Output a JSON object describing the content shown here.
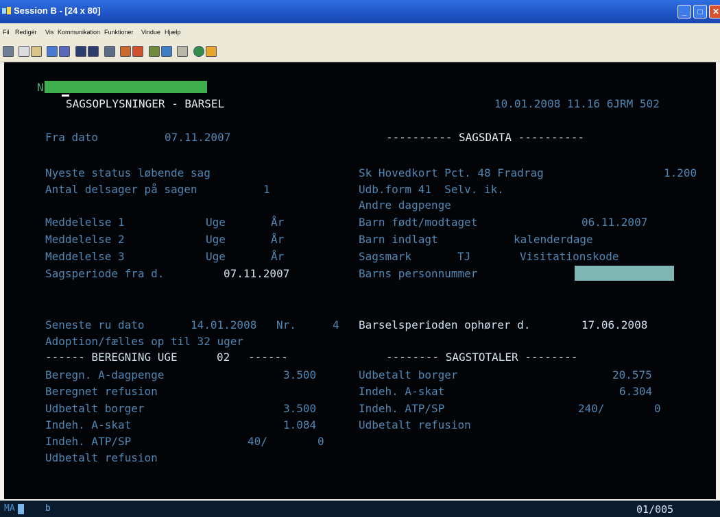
{
  "window": {
    "title": "Session B - [24 x 80]",
    "buttons": {
      "minimize": "_",
      "maximize": "□",
      "close": "✕"
    }
  },
  "menu": [
    "Fil",
    "Redigér",
    "Vis",
    "Kommunikation",
    "Funktioner",
    "Vindue",
    "Hjælp"
  ],
  "toolbar_icons": [
    "print-screen-icon",
    "copy-icon",
    "paste-icon",
    "send-file-icon",
    "receive-file-icon",
    "display-icon",
    "display-alt-icon",
    "printer-icon",
    "macro-record-icon",
    "macro-stop-icon",
    "macro-play-icon",
    "macro-edit-icon",
    "keypad-icon",
    "globe-icon",
    "help-icon"
  ],
  "screen": {
    "cmd_prefix": "N",
    "header": {
      "title": "SAGSOPLYSNINGER - BARSEL",
      "datetime": "10.01.2008 11.16 6JRM 502"
    },
    "fra_dato": {
      "label": "Fra dato",
      "value": "07.11.2007"
    },
    "sagsdata_header": "---------- SAGSDATA ----------",
    "left_status": [
      {
        "label": "Nyeste status løbende sag",
        "value": ""
      },
      {
        "label": "Antal delsager på sagen",
        "value": "1"
      }
    ],
    "sk_hovedkort": {
      "label": "Sk Hovedkort Pct. 48 Fradrag",
      "value": "1.200"
    },
    "udb_form": "Udb.form 41  Selv. ik.",
    "andre_dagpenge": "Andre dagpenge",
    "meddelelser": [
      {
        "label": "Meddelelse 1",
        "uge": "Uge",
        "aar": "År"
      },
      {
        "label": "Meddelelse 2",
        "uge": "Uge",
        "aar": "År"
      },
      {
        "label": "Meddelelse 3",
        "uge": "Uge",
        "aar": "År"
      }
    ],
    "barn_fodt": {
      "label": "Barn født/modtaget",
      "value": "06.11.2007"
    },
    "barn_indlagt": {
      "label": "Barn indlagt",
      "value": "kalenderdage"
    },
    "sagsmark": {
      "label": "Sagsmark",
      "value": "TJ",
      "extra": "Visitationskode"
    },
    "sagsperiode": {
      "label": "Sagsperiode fra d.",
      "value": "07.11.2007"
    },
    "barns_personnummer": "Barns personnummer",
    "seneste_ru": {
      "label": "Seneste ru dato",
      "date": "14.01.2008",
      "nr_label": "Nr.",
      "nr": "4"
    },
    "barselsperioden": {
      "label": "Barselsperioden ophører d.",
      "value": "17.06.2008"
    },
    "adoption": "Adoption/fælles op til 32 uger",
    "beregning_header": "------ BEREGNING UGE",
    "beregning_week": "02",
    "beregning_tail": "------",
    "sagstotaler_header": "-------- SAGSTOTALER --------",
    "beregning": [
      {
        "label": "Beregn. A-dagpenge",
        "value": "3.500"
      },
      {
        "label": "Beregnet refusion",
        "value": ""
      },
      {
        "label": "Udbetalt borger",
        "value": "3.500"
      },
      {
        "label": "Indeh. A-skat",
        "value": "1.084"
      },
      {
        "label": "Indeh. ATP/SP",
        "value": "40/",
        "value2": "0"
      },
      {
        "label": "Udbetalt refusion",
        "value": ""
      }
    ],
    "sagstotaler": [
      {
        "label": "Udbetalt borger",
        "value": "20.575"
      },
      {
        "label": "Indeh. A-skat",
        "value": "6.304"
      },
      {
        "label": "Indeh. ATP/SP",
        "value": "240/",
        "value2": "0"
      },
      {
        "label": "Udbetalt refusion",
        "value": ""
      }
    ]
  },
  "status_bar": {
    "mode": "MA",
    "indicator": "b",
    "position": "01/005"
  },
  "colors": {
    "terminal_bg": "#020407",
    "label_blue": "#4f87b2",
    "value_white": "#cfe1ee",
    "input_green": "#3fae4c",
    "masked_teal": "#7fb5b3"
  }
}
